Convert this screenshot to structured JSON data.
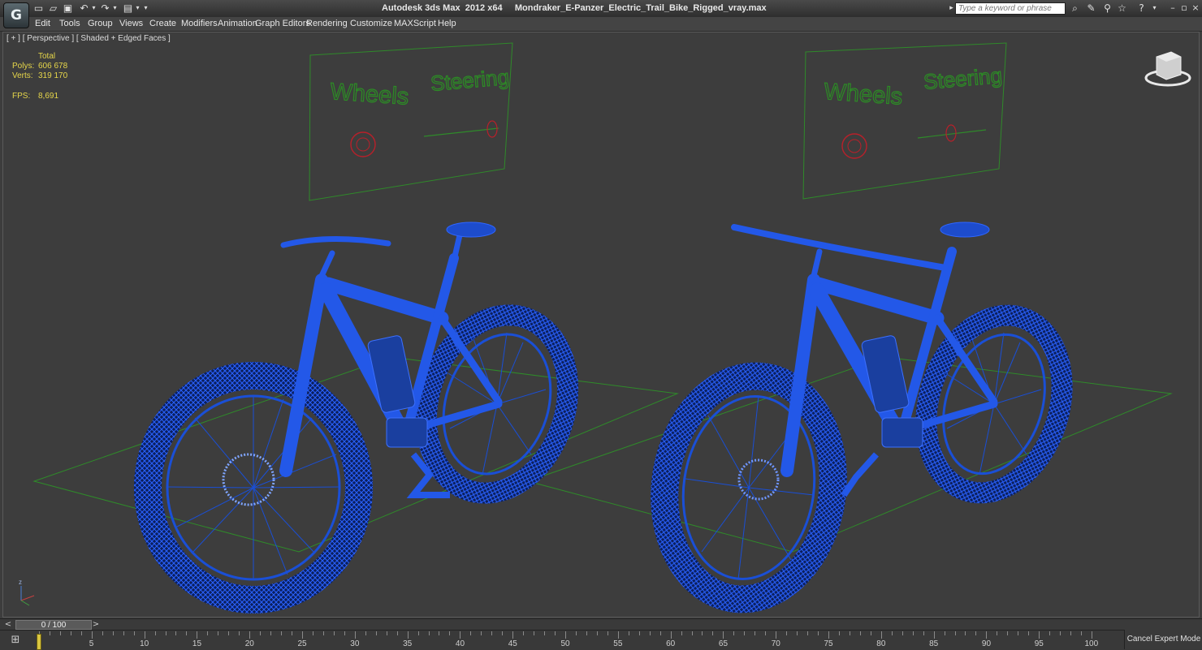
{
  "app": {
    "logo_glyph": "G",
    "title": "Autodesk 3ds Max  2012 x64     Mondraker_E-Panzer_Electric_Trail_Bike_Rigged_vray.max"
  },
  "quick_access": {
    "icons": [
      "new-file-icon",
      "open-file-icon",
      "save-file-icon",
      "undo-icon",
      "redo-icon",
      "project-folder-icon"
    ]
  },
  "search": {
    "placeholder": "Type a keyword or phrase"
  },
  "infocenter": {
    "icons": [
      "binoculars-icon",
      "communication-center-icon",
      "favorites-star-icon",
      "help-icon"
    ]
  },
  "menu": {
    "items": [
      "Edit",
      "Tools",
      "Group",
      "Views",
      "Create",
      "Modifiers",
      "Animation",
      "Graph Editors",
      "Rendering",
      "Customize",
      "MAXScript",
      "Help"
    ]
  },
  "viewport": {
    "label": "[ + ] [ Perspective ] [ Shaded + Edged Faces ]",
    "stats": {
      "header": "Total",
      "polys_label": "Polys:",
      "polys_value": "606 678",
      "verts_label": "Verts:",
      "verts_value": "319 170",
      "fps_label": "FPS:",
      "fps_value": "8,691"
    },
    "panel_labels": {
      "wheels": "Wheels",
      "steering": "Steering"
    },
    "wire_color": "#1a4fd6",
    "grid_color": "#2f8a2a",
    "panel_text_color": "#2c8c25",
    "control_red": "#b8202a"
  },
  "timeslider": {
    "position_text": "0 / 100",
    "prev_glyph": "<",
    "next_glyph": ">"
  },
  "trackbar": {
    "tick_labels": [
      "5",
      "10",
      "15",
      "20",
      "25",
      "30",
      "35",
      "40",
      "45",
      "50",
      "55",
      "60",
      "65",
      "70",
      "75",
      "80",
      "85",
      "90",
      "95",
      "100"
    ]
  },
  "status": {
    "cancel_expert": "Cancel Expert Mode"
  }
}
